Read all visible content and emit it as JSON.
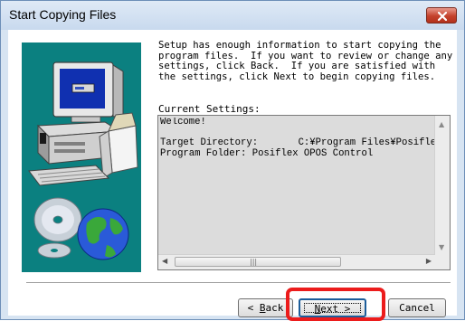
{
  "window": {
    "title": "Start Copying Files"
  },
  "intro_text": "Setup has enough information to start copying the\nprogram files.  If you want to review or change any\nsettings, click Back.  If you are satisfied with\nthe settings, click Next to begin copying files.",
  "settings": {
    "label": "Current Settings:",
    "text": "Welcome!\n\nTarget Directory:       C:¥Program Files¥Posifle\nProgram Folder: Posiflex OPOS Control"
  },
  "buttons": {
    "back": {
      "pre": "< ",
      "key": "B",
      "post": "ack"
    },
    "next": {
      "key": "N",
      "post": "ext >"
    },
    "cancel": "Cancel"
  },
  "colors": {
    "art_background": "#0b8080",
    "highlight": "#ec1c1c",
    "close_button": "#c4412c"
  },
  "icons": {
    "close": "close-x-icon",
    "illustration": "computer-setup-illustration"
  }
}
